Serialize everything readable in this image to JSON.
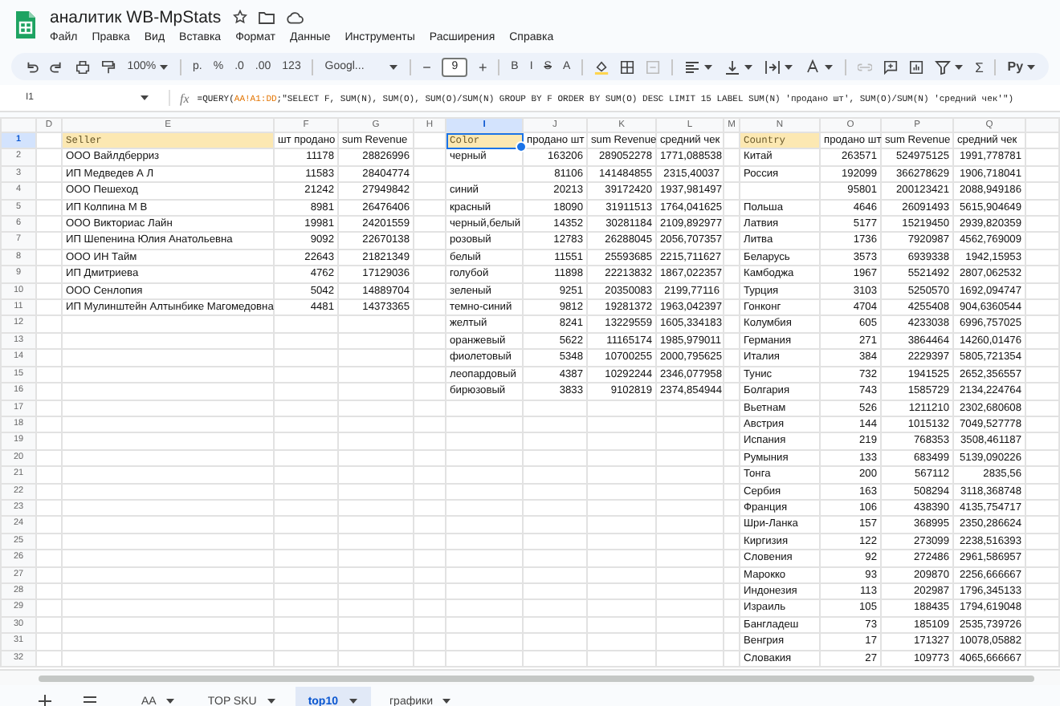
{
  "document": {
    "title": "аналитик WB-MpStats"
  },
  "menu": [
    "Файл",
    "Правка",
    "Вид",
    "Вставка",
    "Формат",
    "Данные",
    "Инструменты",
    "Расширения",
    "Справка"
  ],
  "toolbar": {
    "zoom": "100%",
    "currency": "р.",
    "percent": "%",
    "decrease_decimals": ".0",
    "increase_decimals": ".00",
    "number_format": "123",
    "font": "Googl...",
    "font_size_minus": "−",
    "font_size": "9",
    "font_size_plus": "+",
    "bold": "B",
    "italic": "I",
    "strikethrough": "S",
    "text_color": "A",
    "functions": "Σ",
    "input_tools": "Ру"
  },
  "formula_bar": {
    "cell": "I1",
    "function_label": "fx",
    "formula_start": "=QUERY(",
    "range": "AA!A1:DD",
    "formula_rest": ";\"SELECT F, SUM(N), SUM(O), SUM(O)/SUM(N)  GROUP BY F ORDER BY SUM(O) DESC LIMIT 15  LABEL SUM(N) 'продано шт', SUM(O)/SUM(N) 'средний чек'\")"
  },
  "columns": [
    {
      "label": "D",
      "selected": false
    },
    {
      "label": "E",
      "selected": false
    },
    {
      "label": "F",
      "selected": false
    },
    {
      "label": "G",
      "selected": false
    },
    {
      "label": "H",
      "selected": false
    },
    {
      "label": "I",
      "selected": true
    },
    {
      "label": "J",
      "selected": false
    },
    {
      "label": "K",
      "selected": false
    },
    {
      "label": "L",
      "selected": false
    },
    {
      "label": "M",
      "selected": false
    },
    {
      "label": "N",
      "selected": false
    },
    {
      "label": "O",
      "selected": false
    },
    {
      "label": "P",
      "selected": false
    },
    {
      "label": "Q",
      "selected": false
    }
  ],
  "row_numbers": [
    {
      "label": "1",
      "selected": true
    },
    {
      "label": "2",
      "selected": false
    },
    {
      "label": "3",
      "selected": false
    },
    {
      "label": "4",
      "selected": false
    },
    {
      "label": "5",
      "selected": false
    },
    {
      "label": "6",
      "selected": false
    },
    {
      "label": "7",
      "selected": false
    },
    {
      "label": "8",
      "selected": false
    },
    {
      "label": "9",
      "selected": false
    },
    {
      "label": "10",
      "selected": false
    },
    {
      "label": "11",
      "selected": false
    },
    {
      "label": "12",
      "selected": false
    },
    {
      "label": "13",
      "selected": false
    },
    {
      "label": "14",
      "selected": false
    },
    {
      "label": "15",
      "selected": false
    },
    {
      "label": "16",
      "selected": false
    },
    {
      "label": "17",
      "selected": false
    },
    {
      "label": "18",
      "selected": false
    },
    {
      "label": "19",
      "selected": false
    },
    {
      "label": "20",
      "selected": false
    },
    {
      "label": "21",
      "selected": false
    },
    {
      "label": "22",
      "selected": false
    },
    {
      "label": "23",
      "selected": false
    },
    {
      "label": "24",
      "selected": false
    },
    {
      "label": "25",
      "selected": false
    },
    {
      "label": "26",
      "selected": false
    },
    {
      "label": "27",
      "selected": false
    },
    {
      "label": "28",
      "selected": false
    },
    {
      "label": "29",
      "selected": false
    },
    {
      "label": "30",
      "selected": false
    },
    {
      "label": "31",
      "selected": false
    },
    {
      "label": "32",
      "selected": false
    }
  ],
  "tables": [
    {
      "headers": [
        "Seller",
        "шт продано",
        "sum Revenue"
      ],
      "rows": [
        {
          "label": "ООО Вайлдберриз",
          "values": [
            "11178",
            "28826996"
          ]
        },
        {
          "label": "ИП Медведев А Л",
          "values": [
            "11583",
            "28404774"
          ]
        },
        {
          "label": "ООО Пешеход",
          "values": [
            "21242",
            "27949842"
          ]
        },
        {
          "label": "ИП Колпина М В",
          "values": [
            "8981",
            "26476406"
          ]
        },
        {
          "label": "ООО Викториас Лайн",
          "values": [
            "19981",
            "24201559"
          ]
        },
        {
          "label": "ИП Шепенина Юлия Анатольевна",
          "values": [
            "9092",
            "22670138"
          ]
        },
        {
          "label": "ООО ИН Тайм",
          "values": [
            "22643",
            "21821349"
          ]
        },
        {
          "label": "ИП Дмитриева",
          "values": [
            "4762",
            "17129036"
          ]
        },
        {
          "label": "ООО Сенлопия",
          "values": [
            "5042",
            "14889704"
          ]
        },
        {
          "label": "ИП Мулинштейн Алтынбике Магомедовна",
          "values": [
            "4481",
            "14373365"
          ]
        }
      ]
    },
    {
      "headers": [
        "Color",
        "продано шт",
        "sum Revenue",
        "средний чек"
      ],
      "rows": [
        {
          "label": "черный",
          "values": [
            "163206",
            "289052278",
            "1771,088538"
          ]
        },
        {
          "values": [
            "81106",
            "141484855",
            "2315,40037"
          ]
        },
        {
          "label": "синий",
          "values": [
            "20213",
            "39172420",
            "1937,981497"
          ]
        },
        {
          "label": "красный",
          "values": [
            "18090",
            "31911513",
            "1764,041625"
          ]
        },
        {
          "label": "черный,белый",
          "values": [
            "14352",
            "30281184",
            "2109,892977"
          ]
        },
        {
          "label": "розовый",
          "values": [
            "12783",
            "26288045",
            "2056,707357"
          ]
        },
        {
          "label": "белый",
          "values": [
            "11551",
            "25593685",
            "2215,711627"
          ]
        },
        {
          "label": "голубой",
          "values": [
            "11898",
            "22213832",
            "1867,022357"
          ]
        },
        {
          "label": "зеленый",
          "values": [
            "9251",
            "20350083",
            "2199,77116"
          ]
        },
        {
          "label": "темно-синий",
          "values": [
            "9812",
            "19281372",
            "1963,042397"
          ]
        },
        {
          "label": "желтый",
          "values": [
            "8241",
            "13229559",
            "1605,334183"
          ]
        },
        {
          "label": "оранжевый",
          "values": [
            "5622",
            "11165174",
            "1985,979011"
          ]
        },
        {
          "label": "фиолетовый",
          "values": [
            "5348",
            "10700255",
            "2000,795625"
          ]
        },
        {
          "label": "леопардовый",
          "values": [
            "4387",
            "10292244",
            "2346,077958"
          ]
        },
        {
          "label": "бирюзовый",
          "values": [
            "3833",
            "9102819",
            "2374,854944"
          ]
        }
      ]
    },
    {
      "headers": [
        "Country",
        "продано шт",
        "sum Revenue",
        "средний чек"
      ],
      "rows": [
        {
          "label": "Китай",
          "values": [
            "263571",
            "524975125",
            "1991,778781"
          ]
        },
        {
          "label": "Россия",
          "values": [
            "192099",
            "366278629",
            "1906,718041"
          ]
        },
        {
          "values": [
            "95801",
            "200123421",
            "2088,949186"
          ]
        },
        {
          "label": "Польша",
          "values": [
            "4646",
            "26091493",
            "5615,904649"
          ]
        },
        {
          "label": "Латвия",
          "values": [
            "5177",
            "15219450",
            "2939,820359"
          ]
        },
        {
          "label": "Литва",
          "values": [
            "1736",
            "7920987",
            "4562,769009"
          ]
        },
        {
          "label": "Беларусь",
          "values": [
            "3573",
            "6939338",
            "1942,15953"
          ]
        },
        {
          "label": "Камбоджа",
          "values": [
            "1967",
            "5521492",
            "2807,062532"
          ]
        },
        {
          "label": "Турция",
          "values": [
            "3103",
            "5250570",
            "1692,094747"
          ]
        },
        {
          "label": "Гонконг",
          "values": [
            "4704",
            "4255408",
            "904,6360544"
          ]
        },
        {
          "label": "Колумбия",
          "values": [
            "605",
            "4233038",
            "6996,757025"
          ]
        },
        {
          "label": "Германия",
          "values": [
            "271",
            "3864464",
            "14260,01476"
          ]
        },
        {
          "label": "Италия",
          "values": [
            "384",
            "2229397",
            "5805,721354"
          ]
        },
        {
          "label": "Тунис",
          "values": [
            "732",
            "1941525",
            "2652,356557"
          ]
        },
        {
          "label": "Болгария",
          "values": [
            "743",
            "1585729",
            "2134,224764"
          ]
        },
        {
          "label": "Вьетнам",
          "values": [
            "526",
            "1211210",
            "2302,680608"
          ]
        },
        {
          "label": "Австрия",
          "values": [
            "144",
            "1015132",
            "7049,527778"
          ]
        },
        {
          "label": "Испания",
          "values": [
            "219",
            "768353",
            "3508,461187"
          ]
        },
        {
          "label": "Румыния",
          "values": [
            "133",
            "683499",
            "5139,090226"
          ]
        },
        {
          "label": "Тонга",
          "values": [
            "200",
            "567112",
            "2835,56"
          ]
        },
        {
          "label": "Сербия",
          "values": [
            "163",
            "508294",
            "3118,368748"
          ]
        },
        {
          "label": "Франция",
          "values": [
            "106",
            "438390",
            "4135,754717"
          ]
        },
        {
          "label": "Шри-Ланка",
          "values": [
            "157",
            "368995",
            "2350,286624"
          ]
        },
        {
          "label": "Киргизия",
          "values": [
            "122",
            "273099",
            "2238,516393"
          ]
        },
        {
          "label": "Словения",
          "values": [
            "92",
            "272486",
            "2961,586957"
          ]
        },
        {
          "label": "Марокко",
          "values": [
            "93",
            "209870",
            "2256,666667"
          ]
        },
        {
          "label": "Индонезия",
          "values": [
            "113",
            "202987",
            "1796,345133"
          ]
        },
        {
          "label": "Израиль",
          "values": [
            "105",
            "188435",
            "1794,619048"
          ]
        },
        {
          "label": "Бангладеш",
          "values": [
            "73",
            "185109",
            "2535,739726"
          ]
        },
        {
          "label": "Венгрия",
          "values": [
            "17",
            "171327",
            "10078,05882"
          ]
        },
        {
          "label": "Словакия",
          "values": [
            "27",
            "109773",
            "4065,666667"
          ]
        }
      ]
    }
  ],
  "sheet_tabs": [
    {
      "label": "AA",
      "selected": false
    },
    {
      "label": "TOP SKU",
      "selected": false
    },
    {
      "label": "top10",
      "selected": true
    },
    {
      "label": "графики",
      "selected": false
    }
  ]
}
